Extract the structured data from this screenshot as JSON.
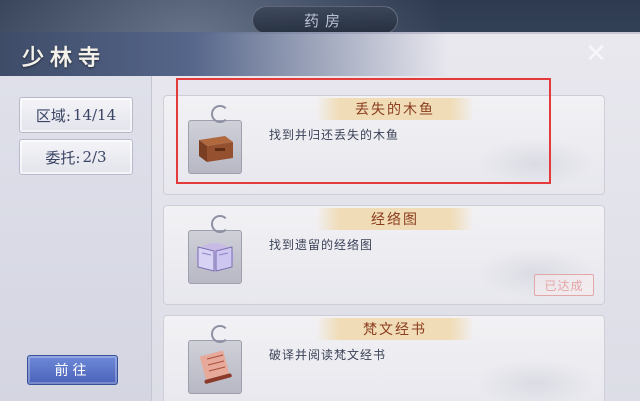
{
  "top_banner": {
    "label": "药房"
  },
  "header": {
    "title": "少林寺"
  },
  "stats": {
    "region": {
      "label": "区域:",
      "value": "14/14"
    },
    "commission": {
      "label": "委托:",
      "value": "2/3"
    }
  },
  "go_button": {
    "label": "前往"
  },
  "quests": [
    {
      "title": "丢失的木鱼",
      "description": "找到并归还丢失的木鱼",
      "icon": "wooden-fish-chest-icon",
      "completed": false,
      "highlighted": true
    },
    {
      "title": "经络图",
      "description": "找到遗留的经络图",
      "icon": "meridian-book-icon",
      "completed": true,
      "stamp": "已达成",
      "highlighted": false
    },
    {
      "title": "梵文经书",
      "description": "破译并阅读梵文经书",
      "icon": "sanskrit-scroll-icon",
      "completed": false,
      "highlighted": false
    }
  ],
  "colors": {
    "highlight": "#e53a3a",
    "title_text": "#8a3d1e",
    "button": "#5a73c8"
  }
}
